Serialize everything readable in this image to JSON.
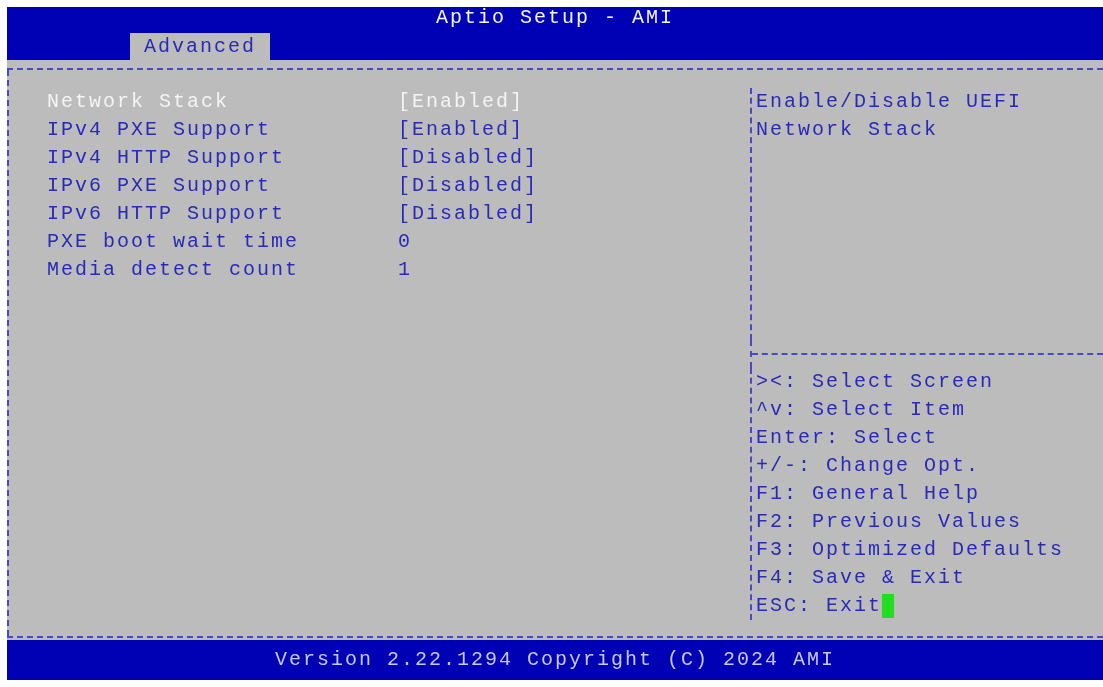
{
  "window": {
    "title": "Aptio Setup - AMI"
  },
  "tabs": [
    {
      "label": "Advanced",
      "selected": true
    }
  ],
  "settings": [
    {
      "label": "Network Stack",
      "value": "[Enabled]",
      "selected": true
    },
    {
      "label": "IPv4 PXE Support",
      "value": "[Enabled]",
      "selected": false
    },
    {
      "label": "IPv4 HTTP Support",
      "value": "[Disabled]",
      "selected": false
    },
    {
      "label": "IPv6 PXE Support",
      "value": "[Disabled]",
      "selected": false
    },
    {
      "label": "IPv6 HTTP Support",
      "value": "[Disabled]",
      "selected": false
    },
    {
      "label": "PXE boot wait time",
      "value": "0",
      "selected": false
    },
    {
      "label": "Media detect count",
      "value": "1",
      "selected": false
    }
  ],
  "help": {
    "lines": [
      "Enable/Disable UEFI",
      "Network Stack"
    ]
  },
  "key_hints": [
    "><: Select Screen",
    "^v: Select Item",
    "Enter: Select",
    "+/-: Change Opt.",
    "F1: General Help",
    "F2: Previous Values",
    "F3: Optimized Defaults",
    "F4: Save & Exit",
    "ESC: Exit"
  ],
  "status_bar": "Version 2.22.1294 Copyright (C) 2024 AMI"
}
